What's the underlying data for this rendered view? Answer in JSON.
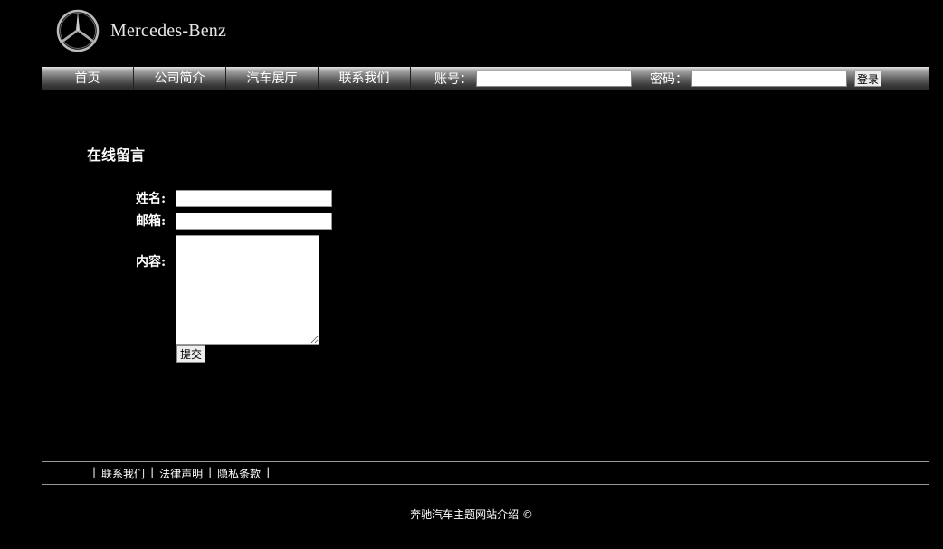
{
  "header": {
    "brand": "Mercedes-Benz"
  },
  "nav": {
    "items": [
      "首页",
      "公司简介",
      "汽车展厅",
      "联系我们"
    ],
    "account_label": "账号：",
    "password_label": "密码：",
    "login_button": "登录"
  },
  "main": {
    "title": "在线留言",
    "form": {
      "name_label": "姓名:",
      "email_label": "邮箱:",
      "content_label": "内容:",
      "submit_label": "提交"
    }
  },
  "footer": {
    "links": [
      "联系我们",
      "法律声明",
      "隐私条款"
    ],
    "separator": "|",
    "copyright": "奔驰汽车主题网站介绍 ©"
  }
}
